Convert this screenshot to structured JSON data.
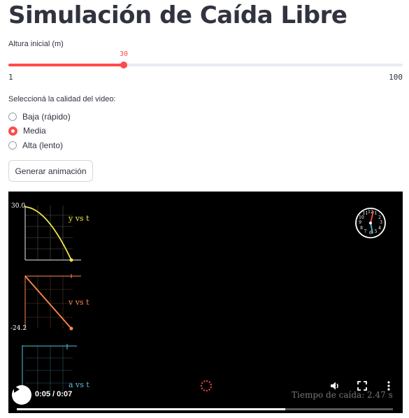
{
  "page": {
    "title": "Simulación de Caída Libre"
  },
  "slider": {
    "label": "Altura inicial (m)",
    "value": "30",
    "min": "1",
    "max": "100",
    "fraction": 0.293
  },
  "quality": {
    "label": "Seleccioná la calidad del video:",
    "options": [
      {
        "label": "Baja (rápido)",
        "selected": false
      },
      {
        "label": "Media",
        "selected": true
      },
      {
        "label": "Alta (lento)",
        "selected": false
      }
    ]
  },
  "button": {
    "label": "Generar animación"
  },
  "video": {
    "graph_y_max": "30.0",
    "graph_y_label": "y vs t",
    "graph_v_label": "v vs t",
    "graph_v_min": "-24.2",
    "graph_a_label": "a vs t",
    "fall_time_text": "Tiempo de caída: 2.47 s",
    "clock_numbers": [
      "12",
      "1",
      "2",
      "3",
      "4",
      "5",
      "6",
      "7",
      "8",
      "9",
      "10",
      "11"
    ],
    "colors": {
      "y": "#f5e94a",
      "v": "#ff8a4a",
      "a": "#58c4dd",
      "accent": "#ff4b4b"
    },
    "controls": {
      "time": "0:05 / 0:07",
      "progress": 0.714,
      "play_icon": "play-icon",
      "volume_icon": "volume-icon",
      "fullscreen_icon": "fullscreen-icon",
      "more_icon": "more-vertical-icon"
    }
  }
}
